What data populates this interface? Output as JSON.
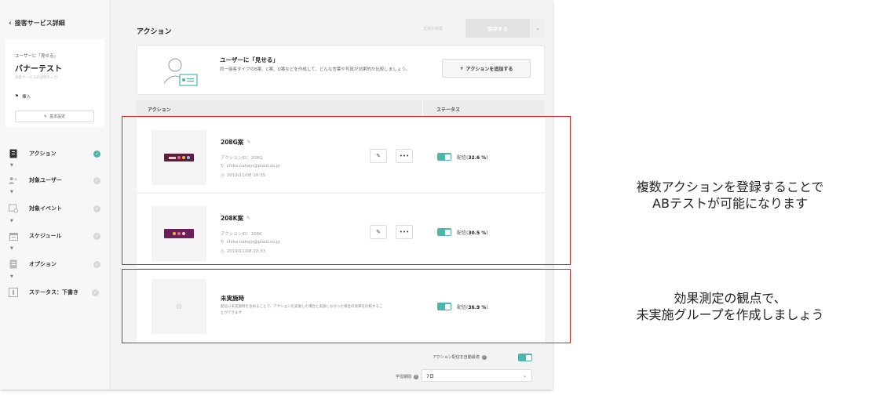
{
  "sidebar": {
    "back_label": "接客サービス詳細",
    "card": {
      "label": "ユーザーに「見せる」",
      "title": "バナーテスト",
      "memo_placeholder": "接客サービスの説明を入力",
      "tag": "挿入",
      "settings_button": "基本設定"
    },
    "nav": [
      {
        "label": "アクション",
        "active": true
      },
      {
        "label": "対象ユーザー",
        "active": false
      },
      {
        "label": "対象イベント",
        "active": false
      },
      {
        "label": "スケジュール",
        "active": false
      },
      {
        "label": "オプション",
        "active": false
      },
      {
        "label": "ステータス：下書き",
        "active": false
      }
    ]
  },
  "header": {
    "title": "アクション",
    "discard_label": "変更を破棄",
    "save_label": "保存する"
  },
  "intro": {
    "title": "ユーザーに「見せる」",
    "description": "同一接客タイプのB案、C案、D案などを作成して、どんな言葉や写真が効果的か比較しましょう。",
    "add_button": "アクションを追加する"
  },
  "table": {
    "col_action": "アクション",
    "col_status": "ステータス",
    "rows": [
      {
        "name": "208G案",
        "id_text": "アクションID：208G",
        "user": "chika.nakajo@plaid.co.jp",
        "date": "2019/11/08 10:35",
        "status": "配信(",
        "percent": "32.6 %",
        "close": ")",
        "banner_color": "#5a1f3d"
      },
      {
        "name": "208K案",
        "id_text": "アクションID：208K",
        "user": "chika.nakajo@plaid.co.jp",
        "date": "2019/11/08 10:33",
        "status": "配信(",
        "percent": "30.5 %",
        "close": ")",
        "banner_color": "#6a1f5a"
      }
    ],
    "control": {
      "name": "未実施時",
      "description": "配信に未実施時を含めることで、アクションを実施した場合と実施しなかった場合の効果を比較することができます",
      "status": "配信(",
      "percent": "36.9 %",
      "close": ")"
    }
  },
  "footer": {
    "auto_label": "アクション配信を自動最適",
    "period_label": "学習期間",
    "period_value": "7日"
  },
  "annotations": {
    "note1": [
      "複数アクションを登録することで",
      "ABテストが可能になります"
    ],
    "note2": [
      "効果測定の観点で、",
      "未実施グループを作成しましょう"
    ]
  },
  "colors": {
    "accent": "#4db6ac",
    "annotation": "#e02020"
  }
}
